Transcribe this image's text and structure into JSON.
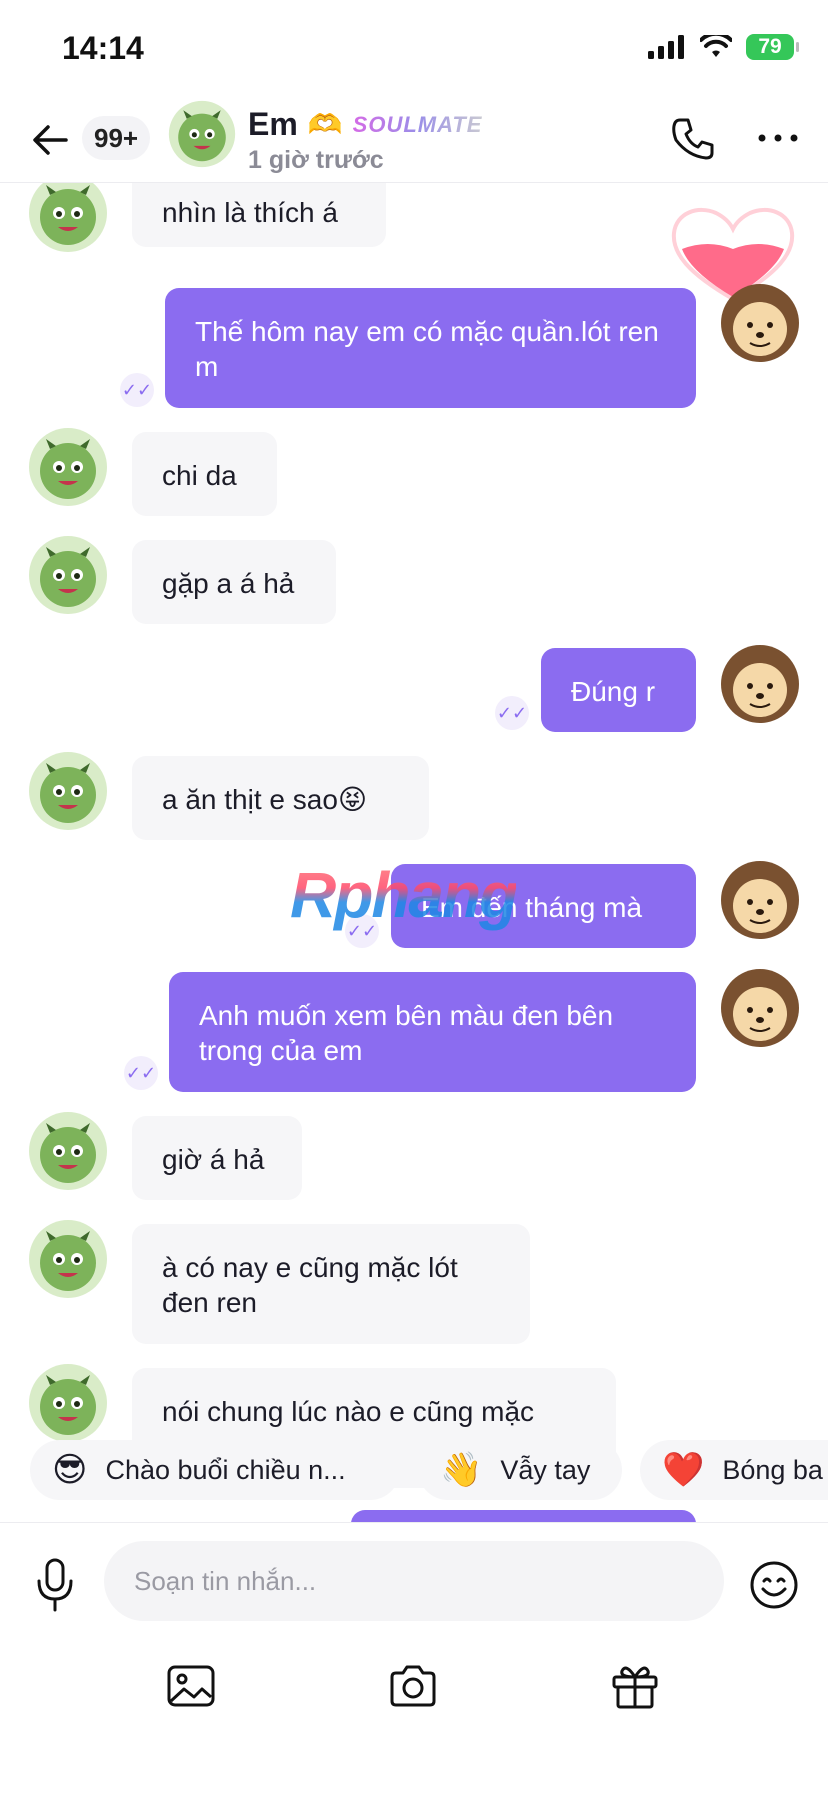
{
  "status_bar": {
    "time": "14:14",
    "battery": "79"
  },
  "header": {
    "unread_badge": "99+",
    "contact_name": "Em",
    "name_emoji": "🫶",
    "tag": "SOULMATE",
    "last_seen": "1 giờ trước"
  },
  "messages": [
    {
      "side": "in",
      "text": "nhìn là thích á"
    },
    {
      "side": "out",
      "text": "Thế hôm nay em có mặc quần.lót ren m"
    },
    {
      "side": "in",
      "text": "chi da"
    },
    {
      "side": "in",
      "text": "gặp a á hả"
    },
    {
      "side": "out",
      "text": "Đúng r"
    },
    {
      "side": "in",
      "text": "a ăn thịt e sao😝"
    },
    {
      "side": "out",
      "text": "Em đến tháng mà"
    },
    {
      "side": "out",
      "text": "Anh muốn xem bên màu đen bên trong của em"
    },
    {
      "side": "in",
      "text": "giờ á hả"
    },
    {
      "side": "in",
      "text": "à có nay e cũng mặc lót đen ren"
    },
    {
      "side": "in",
      "text": "nói chung lúc nào e cũng mặc"
    }
  ],
  "watermark": "Rphang",
  "quick_replies": [
    {
      "icon": "😎",
      "label": "Chào buổi chiều n..."
    },
    {
      "icon": "👋",
      "label": "Vẫy tay"
    },
    {
      "icon": "❤️",
      "label": "Bóng ba"
    }
  ],
  "composer": {
    "placeholder": "Soạn tin nhắn..."
  },
  "colors": {
    "accent": "#8b6cf0",
    "incoming_bubble": "#f6f6f8",
    "battery": "#35c759"
  }
}
